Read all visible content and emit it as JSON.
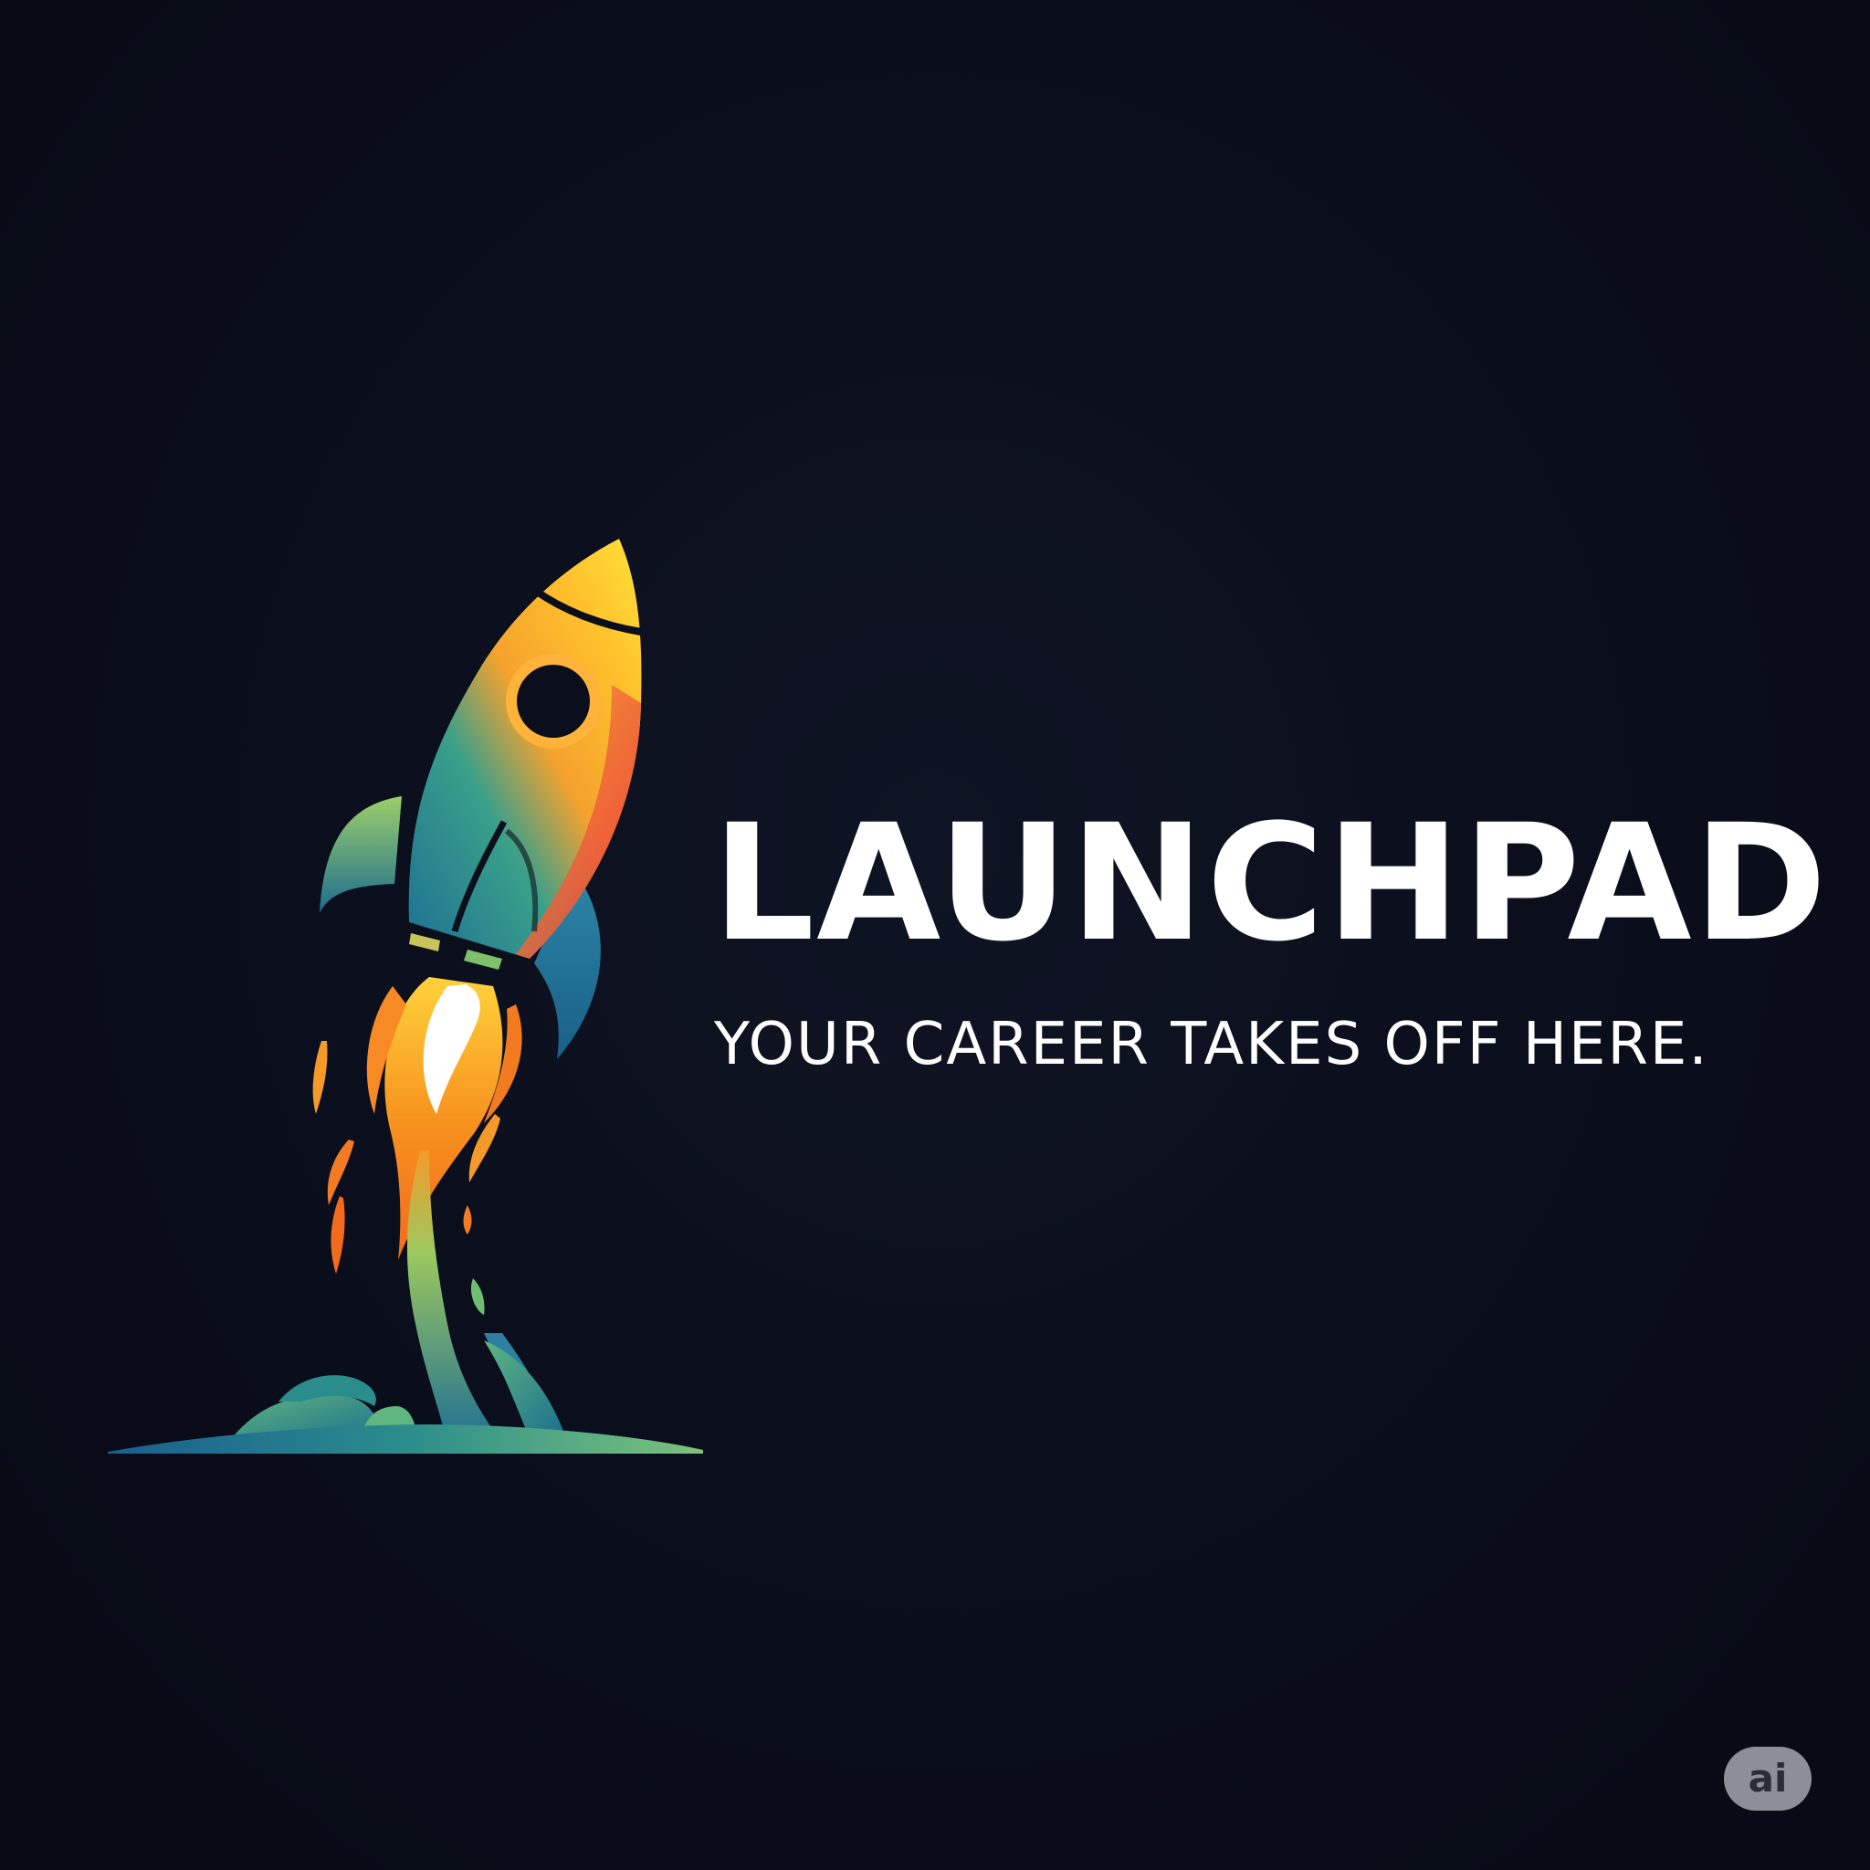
{
  "brand": {
    "name": "LAUNCHPAD",
    "tagline": "YOUR CAREER TAKES OFF HERE."
  },
  "badge": {
    "label": "ai"
  },
  "logo": {
    "icon": "rocket-icon"
  },
  "colors": {
    "background": "#0b0f1c",
    "text": "#ffffff",
    "accent_yellow": "#ffd12a",
    "accent_orange": "#f58a2a",
    "accent_red": "#e23a3c",
    "accent_teal": "#1f7a8c",
    "accent_green": "#6fbf73",
    "badge": "#8c8f96"
  }
}
